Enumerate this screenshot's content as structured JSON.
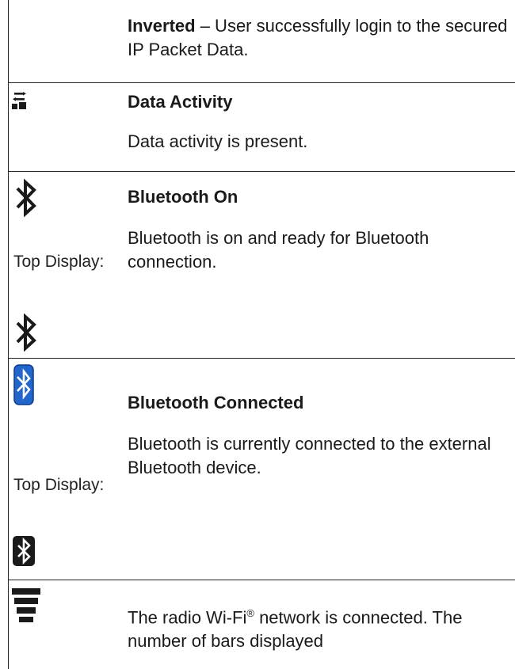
{
  "rows": [
    {
      "title": "Inverted",
      "text": " – User successfully login to the secured IP Packet Data."
    },
    {
      "icon": "data-activity-icon",
      "title": "Data Activity",
      "text": "Data activity is present."
    },
    {
      "icon": "bluetooth-icon",
      "title": "Bluetooth On",
      "text": "Bluetooth is on and ready for Bluetooth connection.",
      "top_label": "Top Display:",
      "top_icon": "bluetooth-icon"
    },
    {
      "icon": "bluetooth-connected-icon",
      "title": "Bluetooth Connected",
      "text": "Bluetooth is currently connected to the external Bluetooth device.",
      "top_label": "Top Display:",
      "top_icon": "bluetooth-connected-inverted-icon"
    },
    {
      "icon": "wifi-bars-icon",
      "text_main": "The radio Wi-Fi",
      "text_reg": "®",
      "text_rest": " network is connected. The number of bars displayed"
    }
  ],
  "colors": {
    "bluetooth_blue": "#2266cc",
    "ink": "#1a1a1a"
  }
}
